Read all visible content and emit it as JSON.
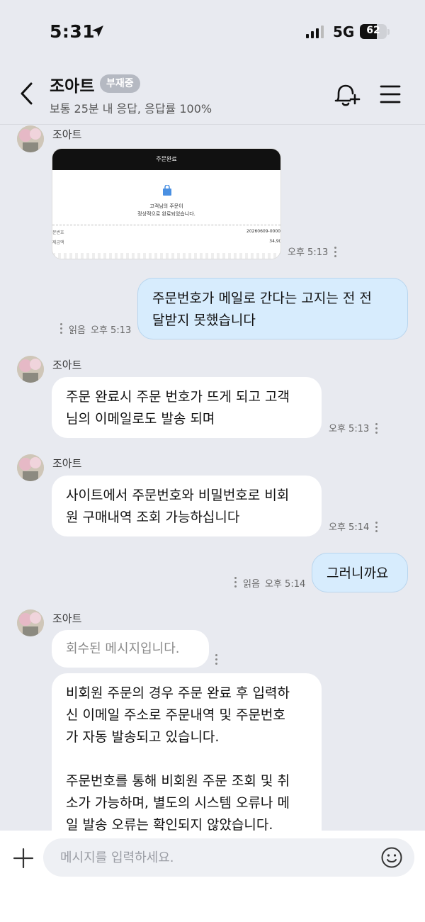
{
  "status_bar": {
    "time": "5:31",
    "network": "5G",
    "battery_percent": "62",
    "battery_level": 0.62,
    "icons": [
      "location-arrow-icon",
      "signal-bars-icon",
      "battery-icon"
    ]
  },
  "header": {
    "name": "조아트",
    "status_badge": "부재중",
    "subtitle": "보통 25분 내 응답, 응답률 100%",
    "icons": [
      "back-chevron-icon",
      "bell-plus-icon",
      "hamburger-menu-icon"
    ]
  },
  "chat": {
    "sender_name": "조아트",
    "image_message": {
      "header_title": "주문완료",
      "line1": "고객님의 주문이",
      "line2": "정상적으로 완료되었습니다.",
      "row1_label": "문번호",
      "row1_value": "20260609-0000",
      "row2_label": "제금액",
      "row2_value": "34,9(",
      "time": "오후 5:13"
    },
    "messages": [
      {
        "direction": "outgoing",
        "text": "주문번호가 메일로 간다는 고지는 전 전\n달받지 못했습니다",
        "read": "읽음",
        "time": "오후 5:13"
      },
      {
        "direction": "incoming",
        "text": "주문 완료시 주문 번호가 뜨게 되고 고객\n님의 이메일로도 발송 되며",
        "time": "오후 5:13"
      },
      {
        "direction": "incoming",
        "text": "사이트에서 주문번호와 비밀번호로 비회\n원 구매내역 조회 가능하십니다",
        "time": "오후 5:14"
      },
      {
        "direction": "outgoing",
        "text": "그러니까요",
        "read": "읽음",
        "time": "오후 5:14"
      },
      {
        "direction": "incoming",
        "text": "회수된 메시지입니다.",
        "recalled": true
      },
      {
        "direction": "incoming",
        "text": "비회원 주문의 경우 주문 완료 후 입력하\n신 이메일 주소로 주문내역 및 주문번호\n가 자동 발송되고 있습니다.\n\n주문번호를 통해 비회원 주문 조회 및 취\n소가 가능하며, 별도의 시스템 오류나 메\n일 발송 오류는 확인되지 않았습니다."
      }
    ]
  },
  "input_bar": {
    "placeholder": "메시지를 입력하세요.",
    "icons": [
      "plus-icon",
      "emoji-icon"
    ]
  }
}
